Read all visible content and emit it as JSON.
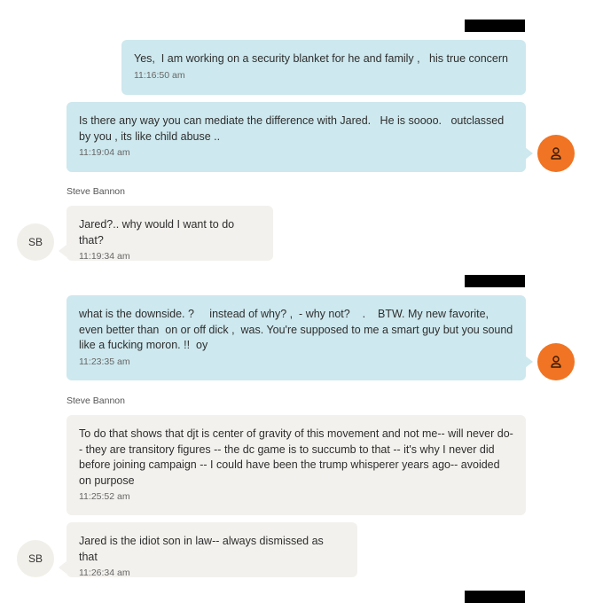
{
  "messages": [
    {
      "text": "Yes,  I am working on a security blanket for he and family ,   his true concern",
      "time": "11:16:50 am"
    },
    {
      "text": "Is there any way you can mediate the difference with Jared.   He is soooo.   outclassed by you , its like child abuse ..",
      "time": "11:19:04 am"
    },
    {
      "sender": "Steve Bannon",
      "avatar": "SB",
      "text": "Jared?.. why would I want to do that?",
      "time": "11:19:34 am"
    },
    {
      "text": "what is the downside. ?     instead of why? ,  - why not?    .    BTW. My new favorite,    even better than  on or off dick ,  was. You're supposed to me a smart guy but you sound like a fucking moron. !!  oy",
      "time": "11:23:35 am"
    },
    {
      "sender": "Steve Bannon",
      "text": "To do that shows that djt is center of gravity of this movement and not me-- will never do-- they are transitory figures -- the dc game is to succumb to that -- it's why I never did before joining campaign -- I could have been the trump whisperer years ago-- avoided on purpose",
      "time": "11:25:52 am"
    },
    {
      "avatar": "SB",
      "text": "Jared is the idiot son in law-- always dismissed as that",
      "time": "11:26:34 am"
    }
  ],
  "icons": {
    "me_avatar": "person-icon",
    "me_avatar_color": "#f07423",
    "outgoing_bubble_color": "#cde8ee",
    "incoming_bubble_color": "#f3f1ed"
  }
}
